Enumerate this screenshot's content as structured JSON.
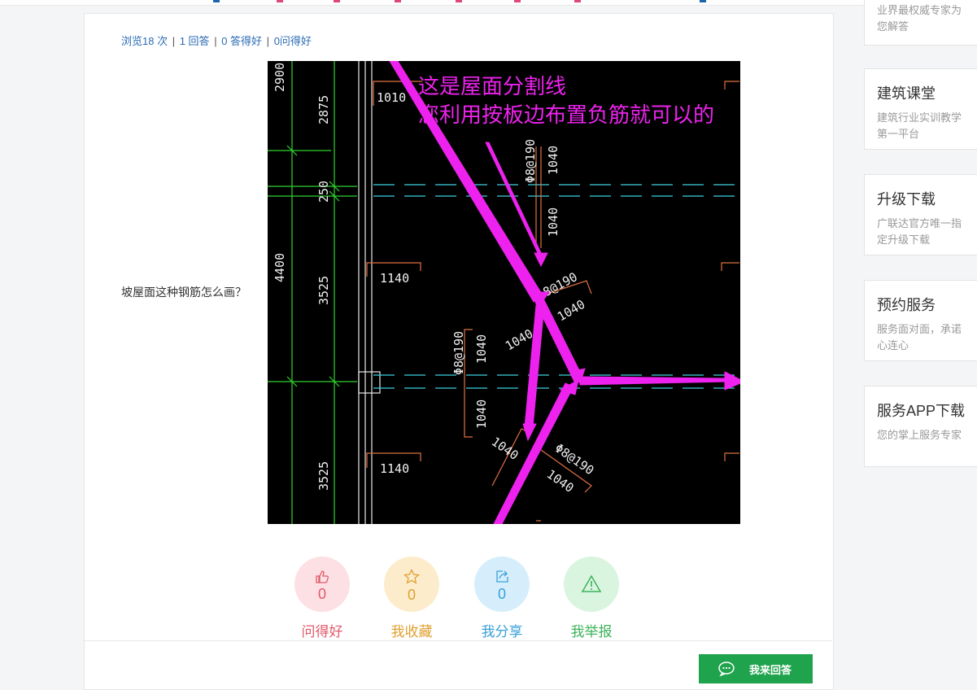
{
  "stats": {
    "views": "浏览18 次",
    "answers": "1 回答",
    "good_answers": "0 答得好",
    "good_questions": "0问得好",
    "separator": "|"
  },
  "question": {
    "text": "坡屋面这种钢筋怎么画？"
  },
  "cad_image": {
    "annotation_line1": "这是屋面分割线",
    "annotation_line2": "您利用按板边布置负筋就可以的",
    "dimensions_left": [
      "2900",
      "2875",
      "250",
      "4400",
      "3525",
      "3525"
    ],
    "rebar_labels": [
      "1010",
      "1140",
      "1140",
      "1040",
      "1040",
      "1040",
      "1040",
      "1040",
      "1040",
      "1040",
      "1040",
      "1040"
    ],
    "spacing_labels": [
      "Φ8@190",
      "Φ8@190",
      "Φ8@190",
      "Φ8@190"
    ]
  },
  "actions": [
    {
      "name": "like",
      "count": "0",
      "label": "问得好",
      "color": "#e05a6a",
      "bg": "#fde0e3"
    },
    {
      "name": "favorite",
      "count": "0",
      "label": "我收藏",
      "color": "#e0a030",
      "bg": "#fdeccc"
    },
    {
      "name": "share",
      "count": "0",
      "label": "我分享",
      "color": "#3aa0d8",
      "bg": "#d6eefb"
    },
    {
      "name": "report",
      "count": "0",
      "label": "我举报",
      "color": "#3db35a",
      "bg": "#d9f4df"
    }
  ],
  "answer_button": {
    "label": "我来回答",
    "color": "#1fa34d"
  },
  "sidebar": [
    {
      "title": "",
      "desc": "业界最权威专家为您解答"
    },
    {
      "title": "建筑课堂",
      "desc": "建筑行业实训教学第一平台"
    },
    {
      "title": "升级下载",
      "desc": "广联达官方唯一指定升级下载"
    },
    {
      "title": "预约服务",
      "desc": "服务面对面，承诺心连心"
    },
    {
      "title": "服务APP下载",
      "desc": "您的掌上服务专家"
    }
  ]
}
